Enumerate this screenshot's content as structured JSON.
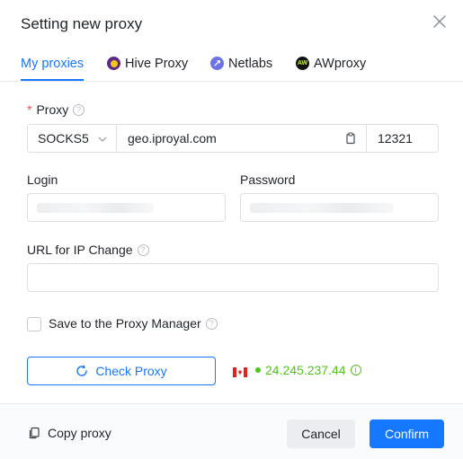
{
  "dialog": {
    "title": "Setting new proxy"
  },
  "tabs": [
    {
      "label": "My proxies",
      "active": true
    },
    {
      "label": "Hive Proxy",
      "icon": "hive-proxy-logo-icon"
    },
    {
      "label": "Netlabs",
      "icon": "netlabs-logo-icon"
    },
    {
      "label": "AWproxy",
      "icon": "awproxy-logo-icon",
      "logo_text": "AW"
    }
  ],
  "form": {
    "proxy_label": "Proxy",
    "required_mark": "*",
    "proxy_type": "SOCKS5",
    "proxy_host": "geo.iproyal.com",
    "proxy_port": "12321",
    "login_label": "Login",
    "password_label": "Password",
    "url_change_label": "URL for IP Change",
    "url_change_value": "",
    "save_label": "Save to the Proxy Manager",
    "save_checked": false,
    "help_glyph": "?"
  },
  "check": {
    "button_label": "Check Proxy",
    "country_flag": "canada-flag-icon",
    "ip": "24.245.237.44",
    "info_glyph": "i"
  },
  "footer": {
    "copy_label": "Copy proxy",
    "cancel_label": "Cancel",
    "confirm_label": "Confirm"
  },
  "colors": {
    "primary": "#1677ff",
    "success": "#52c41a",
    "required": "#ff4d4f"
  }
}
